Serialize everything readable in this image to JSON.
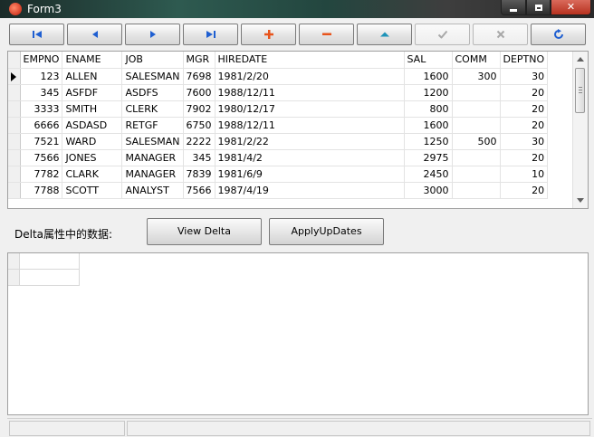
{
  "window": {
    "title": "Form3"
  },
  "navigator": {
    "buttons": [
      {
        "name": "first",
        "icon": "first-record-icon",
        "enabled": true
      },
      {
        "name": "prior",
        "icon": "prior-record-icon",
        "enabled": true
      },
      {
        "name": "next",
        "icon": "next-record-icon",
        "enabled": true
      },
      {
        "name": "last",
        "icon": "last-record-icon",
        "enabled": true
      },
      {
        "name": "insert",
        "icon": "plus-icon",
        "enabled": true
      },
      {
        "name": "delete",
        "icon": "minus-icon",
        "enabled": true
      },
      {
        "name": "edit",
        "icon": "triangle-up-icon",
        "enabled": true
      },
      {
        "name": "post",
        "icon": "check-icon",
        "enabled": false
      },
      {
        "name": "cancel",
        "icon": "x-icon",
        "enabled": false
      },
      {
        "name": "refresh",
        "icon": "refresh-icon",
        "enabled": true
      }
    ],
    "colors": {
      "blue": "#1f5fd1",
      "orange": "#e8541c",
      "teal": "#1d93b8",
      "disabled": "#a8a8a8"
    }
  },
  "grid": {
    "columns": [
      "EMPNO",
      "ENAME",
      "JOB",
      "MGR",
      "HIREDATE",
      "SAL",
      "COMM",
      "DEPTNO"
    ],
    "rows": [
      [
        "123",
        "ALLEN",
        "SALESMAN",
        "7698",
        "1981/2/20",
        "1600",
        "300",
        "30"
      ],
      [
        "345",
        "ASFDF",
        "ASDFS",
        "7600",
        "1988/12/11",
        "1200",
        "",
        "20"
      ],
      [
        "3333",
        "SMITH",
        "CLERK",
        "7902",
        "1980/12/17",
        "800",
        "",
        "20"
      ],
      [
        "6666",
        "ASDASD",
        "RETGF",
        "6750",
        "1988/12/11",
        "1600",
        "",
        "20"
      ],
      [
        "7521",
        "WARD",
        "SALESMAN",
        "2222",
        "1981/2/22",
        "1250",
        "500",
        "30"
      ],
      [
        "7566",
        "JONES",
        "MANAGER",
        "345",
        "1981/4/2",
        "2975",
        "",
        "20"
      ],
      [
        "7782",
        "CLARK",
        "MANAGER",
        "7839",
        "1981/6/9",
        "2450",
        "",
        "10"
      ],
      [
        "7788",
        "SCOTT",
        "ANALYST",
        "7566",
        "1987/4/19",
        "3000",
        "",
        "20"
      ]
    ],
    "current_row": 0
  },
  "delta": {
    "label": "Delta属性中的数据:",
    "view_button": "View Delta",
    "apply_button": "ApplyUpDates"
  }
}
